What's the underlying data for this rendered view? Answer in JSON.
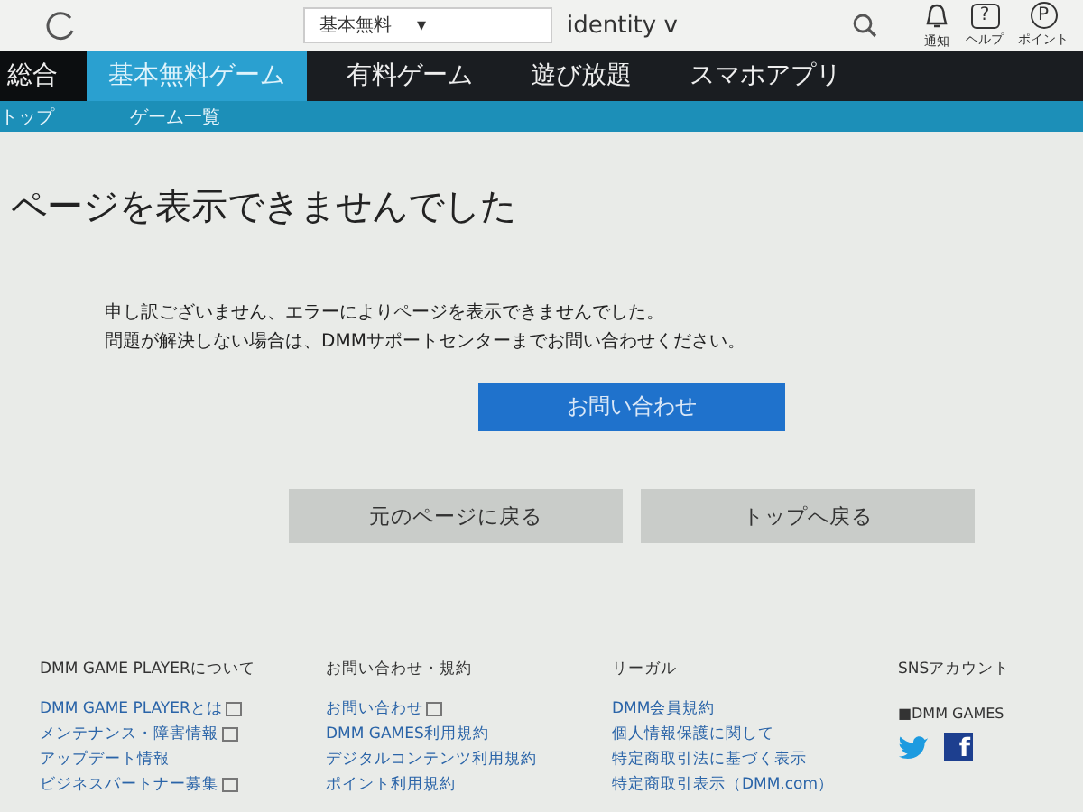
{
  "topbar": {
    "category": "基本無料",
    "caret": "▾",
    "search_value": "identity v",
    "icons": [
      {
        "kind": "bell",
        "label": "通知"
      },
      {
        "kind": "help",
        "label": "ヘルプ",
        "glyph": "?"
      },
      {
        "kind": "point",
        "label": "ポイント",
        "glyph": "P"
      }
    ]
  },
  "nav": {
    "tabs": [
      {
        "label": "総合",
        "selected": false
      },
      {
        "label": "基本無料ゲーム",
        "selected": true
      },
      {
        "label": "有料ゲーム",
        "selected": false
      },
      {
        "label": "遊び放題",
        "selected": false
      },
      {
        "label": "スマホアプリ",
        "selected": false
      }
    ],
    "subnav": [
      "トップ",
      "ゲーム一覧"
    ]
  },
  "error": {
    "title": "ページを表示できませんでした",
    "message": [
      "申し訳ございません、エラーによりページを表示できませんでした。",
      "問題が解決しない場合は、DMMサポートセンターまでお問い合わせください。"
    ],
    "contact_button": "お問い合わせ",
    "back_buttons": [
      "元のページに戻る",
      "トップへ戻る"
    ]
  },
  "footer": {
    "columns": [
      {
        "heading": "DMM GAME PLAYERについて",
        "links": [
          {
            "label": "DMM GAME PLAYERとは",
            "external": true
          },
          {
            "label": "メンテナンス・障害情報",
            "external": true
          },
          {
            "label": "アップデート情報",
            "external": false
          },
          {
            "label": "ビジネスパートナー募集",
            "external": true
          }
        ]
      },
      {
        "heading": "お問い合わせ・規約",
        "links": [
          {
            "label": "お問い合わせ",
            "external": true
          },
          {
            "label": "DMM GAMES利用規約",
            "external": false
          },
          {
            "label": "デジタルコンテンツ利用規約",
            "external": false
          },
          {
            "label": "ポイント利用規約",
            "external": false
          }
        ]
      },
      {
        "heading": "リーガル",
        "links": [
          {
            "label": "DMM会員規約",
            "external": false
          },
          {
            "label": "個人情報保護に関して",
            "external": false
          },
          {
            "label": "特定商取引法に基づく表示",
            "external": false
          },
          {
            "label": "特定商取引表示（DMM.com）",
            "external": false
          }
        ]
      }
    ],
    "sns": {
      "heading": "SNSアカウント",
      "account": "■DMM GAMES",
      "icons": [
        {
          "kind": "bird"
        },
        {
          "kind": "facebook",
          "glyph": "f"
        }
      ]
    }
  }
}
